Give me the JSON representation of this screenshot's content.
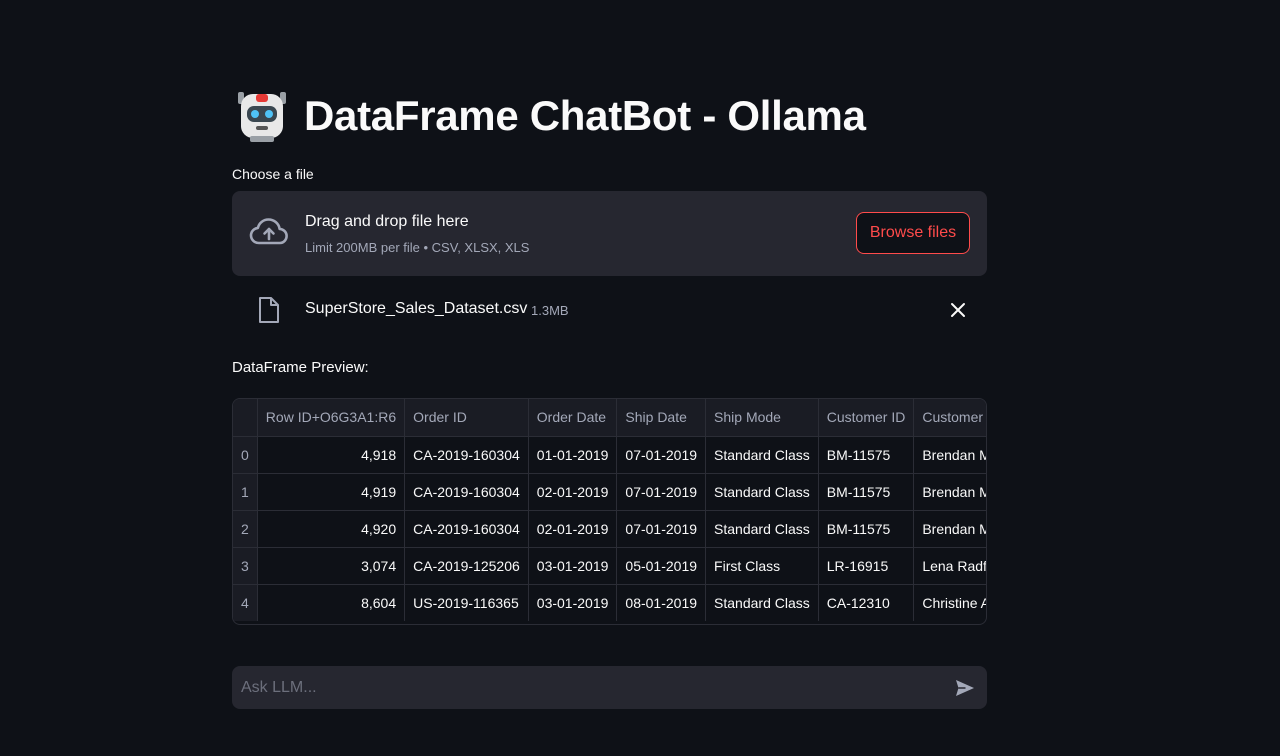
{
  "header": {
    "robot_emoji_name": "robot-face-icon",
    "title": "DataFrame ChatBot - Ollama"
  },
  "uploader": {
    "label": "Choose a file",
    "drop_title": "Drag and drop file here",
    "drop_subtitle": "Limit 200MB per file • CSV, XLSX, XLS",
    "browse_label": "Browse files",
    "accent_color": "#ff4b4b"
  },
  "uploaded_file": {
    "name": "SuperStore_Sales_Dataset.csv",
    "size": "1.3MB"
  },
  "preview": {
    "label": "DataFrame Preview:",
    "columns": [
      "",
      "Row ID+O6G3A1:R6",
      "Order ID",
      "Order Date",
      "Ship Date",
      "Ship Mode",
      "Customer ID",
      "Customer Name"
    ],
    "rows": [
      [
        "0",
        "4,918",
        "CA-2019-160304",
        "01-01-2019",
        "07-01-2019",
        "Standard Class",
        "BM-11575",
        "Brendan Murry"
      ],
      [
        "1",
        "4,919",
        "CA-2019-160304",
        "02-01-2019",
        "07-01-2019",
        "Standard Class",
        "BM-11575",
        "Brendan Murry"
      ],
      [
        "2",
        "4,920",
        "CA-2019-160304",
        "02-01-2019",
        "07-01-2019",
        "Standard Class",
        "BM-11575",
        "Brendan Murry"
      ],
      [
        "3",
        "3,074",
        "CA-2019-125206",
        "03-01-2019",
        "05-01-2019",
        "First Class",
        "LR-16915",
        "Lena Radford"
      ],
      [
        "4",
        "8,604",
        "US-2019-116365",
        "03-01-2019",
        "08-01-2019",
        "Standard Class",
        "CA-12310",
        "Christine Abelman"
      ]
    ]
  },
  "chat": {
    "placeholder": "Ask LLM..."
  },
  "colors": {
    "background": "#0e1117",
    "panel": "#262730",
    "text": "#fafafa",
    "muted": "#a3a8b8"
  }
}
